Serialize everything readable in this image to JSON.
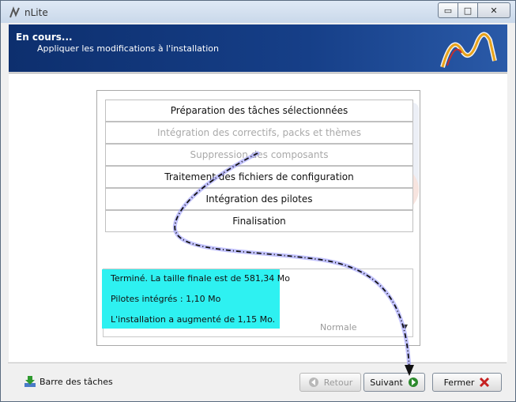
{
  "window": {
    "title": "nLite",
    "controls": {
      "minimize": "▭",
      "maximize": "□",
      "close": "✕"
    }
  },
  "header": {
    "title": "En cours...",
    "subtitle": "Appliquer les modifications à l'installation"
  },
  "steps": [
    {
      "label": "Préparation des tâches sélectionnées",
      "state": "active"
    },
    {
      "label": "Intégration des correctifs, packs et thèmes",
      "state": "disabled"
    },
    {
      "label": "Suppression des composants",
      "state": "disabled"
    },
    {
      "label": "Traitement des fichiers de configuration",
      "state": "active"
    },
    {
      "label": "Intégration des pilotes",
      "state": "active"
    },
    {
      "label": "Finalisation",
      "state": "active"
    }
  ],
  "log": {
    "line1": "Terminé. La taille finale est de 581,34 Mo",
    "line2": "Pilotes intégrés : 1,10 Mo",
    "line3": "L'installation a augmenté de 1,15 Mo."
  },
  "priority": {
    "value": "Normale"
  },
  "footer": {
    "taskbar_label": "Barre des tâches",
    "back_label": "Retour",
    "next_label": "Suivant",
    "close_label": "Fermer"
  },
  "colors": {
    "header_bg": "#0d2f6e",
    "highlight": "#2ef1f1",
    "annotation_line": "#7b7bff"
  },
  "icons": {
    "taskbar": "download-arrow-icon",
    "back": "back-arrow-icon",
    "next": "next-arrow-icon",
    "close": "red-x-icon"
  }
}
